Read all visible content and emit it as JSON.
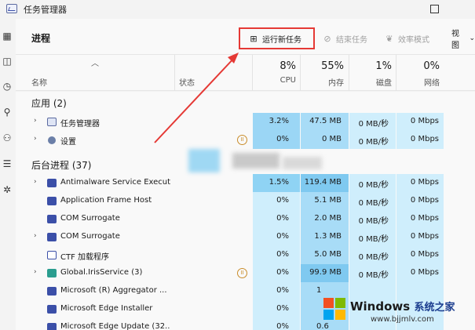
{
  "window": {
    "title": "任务管理器"
  },
  "toolbar": {
    "page_title": "进程",
    "run_new_task": "运行新任务",
    "end_task": "结束任务",
    "efficiency_mode": "效率模式",
    "view": "视图",
    "view_chevron": "⌄"
  },
  "header": {
    "name": "名称",
    "status": "状态",
    "cpu_pct": "8%",
    "cpu": "CPU",
    "mem_pct": "55%",
    "mem": "内存",
    "disk_pct": "1%",
    "disk": "磁盘",
    "net_pct": "0%",
    "net": "网络"
  },
  "groups": {
    "apps": "应用 (2)",
    "background": "后台进程 (37)"
  },
  "rows": [
    {
      "name": "任务管理器",
      "cpu": "3.2%",
      "mem": "47.5 MB",
      "disk": "0 MB/秒",
      "net": "0 Mbps"
    },
    {
      "name": "设置",
      "cpu": "0%",
      "mem": "0 MB",
      "disk": "0 MB/秒",
      "net": "0 Mbps"
    },
    {
      "name": "Antimalware Service Execut...",
      "cpu": "1.5%",
      "mem": "119.4 MB",
      "disk": "0 MB/秒",
      "net": "0 Mbps"
    },
    {
      "name": "Application Frame Host",
      "cpu": "0%",
      "mem": "5.1 MB",
      "disk": "0 MB/秒",
      "net": "0 Mbps"
    },
    {
      "name": "COM Surrogate",
      "cpu": "0%",
      "mem": "2.0 MB",
      "disk": "0 MB/秒",
      "net": "0 Mbps"
    },
    {
      "name": "COM Surrogate",
      "cpu": "0%",
      "mem": "1.3 MB",
      "disk": "0 MB/秒",
      "net": "0 Mbps"
    },
    {
      "name": "CTF 加载程序",
      "cpu": "0%",
      "mem": "5.0 MB",
      "disk": "0 MB/秒",
      "net": "0 Mbps"
    },
    {
      "name": "Global.IrisService (3)",
      "cpu": "0%",
      "mem": "99.9 MB",
      "disk": "0 MB/秒",
      "net": "0 Mbps"
    },
    {
      "name": "Microsoft (R) Aggregator ...",
      "cpu": "0%",
      "mem": "1",
      "disk": "",
      "net": ""
    },
    {
      "name": "Microsoft Edge Installer",
      "cpu": "0%",
      "mem": "",
      "disk": "",
      "net": ""
    },
    {
      "name": "Microsoft Edge Update (32...",
      "cpu": "0%",
      "mem": "0.6",
      "disk": "",
      "net": ""
    }
  ],
  "status_icon": "pause-icon",
  "watermark": {
    "brand": "Windows",
    "brand_cn": "系统之家",
    "url": "www.bjjmlv.com"
  },
  "colors": {
    "cpu_heat": "#8fd3f4",
    "mem_heat": "#a8dcf7",
    "light_heat": "#cfeefc",
    "accent_red": "#e53935"
  }
}
